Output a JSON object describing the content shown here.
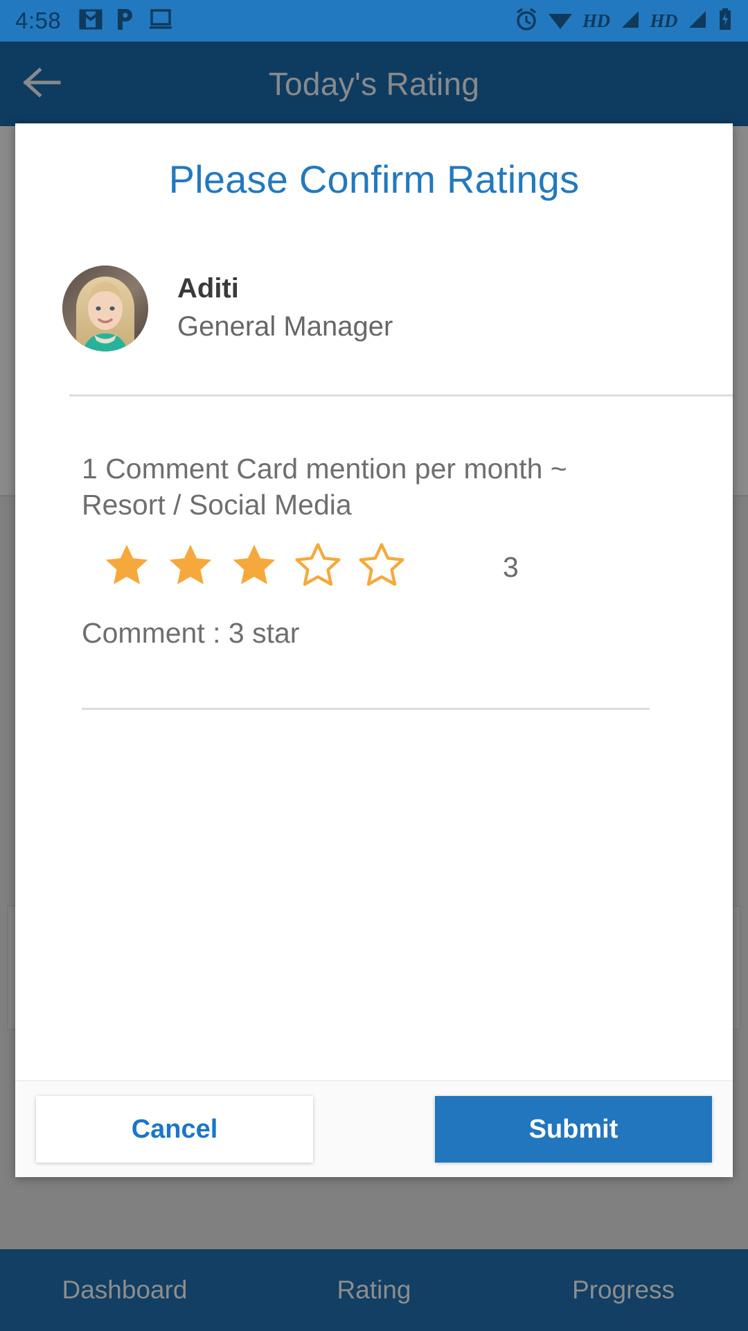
{
  "status_bar": {
    "time": "4:58",
    "left_icons": [
      "gmail-icon",
      "pandora-icon",
      "cast-screen-icon"
    ],
    "right_icons": [
      "alarm-icon",
      "wifi-icon",
      "hd-label",
      "signal-icon",
      "hd-label",
      "signal-icon",
      "battery-charging-icon"
    ],
    "hd_label": "HD",
    "background": "#2279bf"
  },
  "app_bar": {
    "back_icon": "arrow-left-icon",
    "title": "Today's Rating",
    "background": "#0e3c61"
  },
  "dialog": {
    "title": "Please Confirm Ratings",
    "title_color": "#2379bd",
    "person": {
      "avatar": "user-photo-avatar",
      "name": "Aditi",
      "role": "General Manager"
    },
    "rating_items": [
      {
        "question": "1 Comment Card mention per month ~ Resort / Social Media",
        "stars_filled": 3,
        "stars_total": 5,
        "star_color": "#f5a93c",
        "value": "3",
        "comment": "Comment : 3 star"
      }
    ],
    "actions": {
      "cancel_label": "Cancel",
      "submit_label": "Submit",
      "submit_color": "#2276bd",
      "cancel_text_color": "#1b76c8"
    }
  },
  "bottom_nav": {
    "items": [
      {
        "label": "Dashboard"
      },
      {
        "label": "Rating"
      },
      {
        "label": "Progress"
      }
    ],
    "background": "#123f63"
  }
}
